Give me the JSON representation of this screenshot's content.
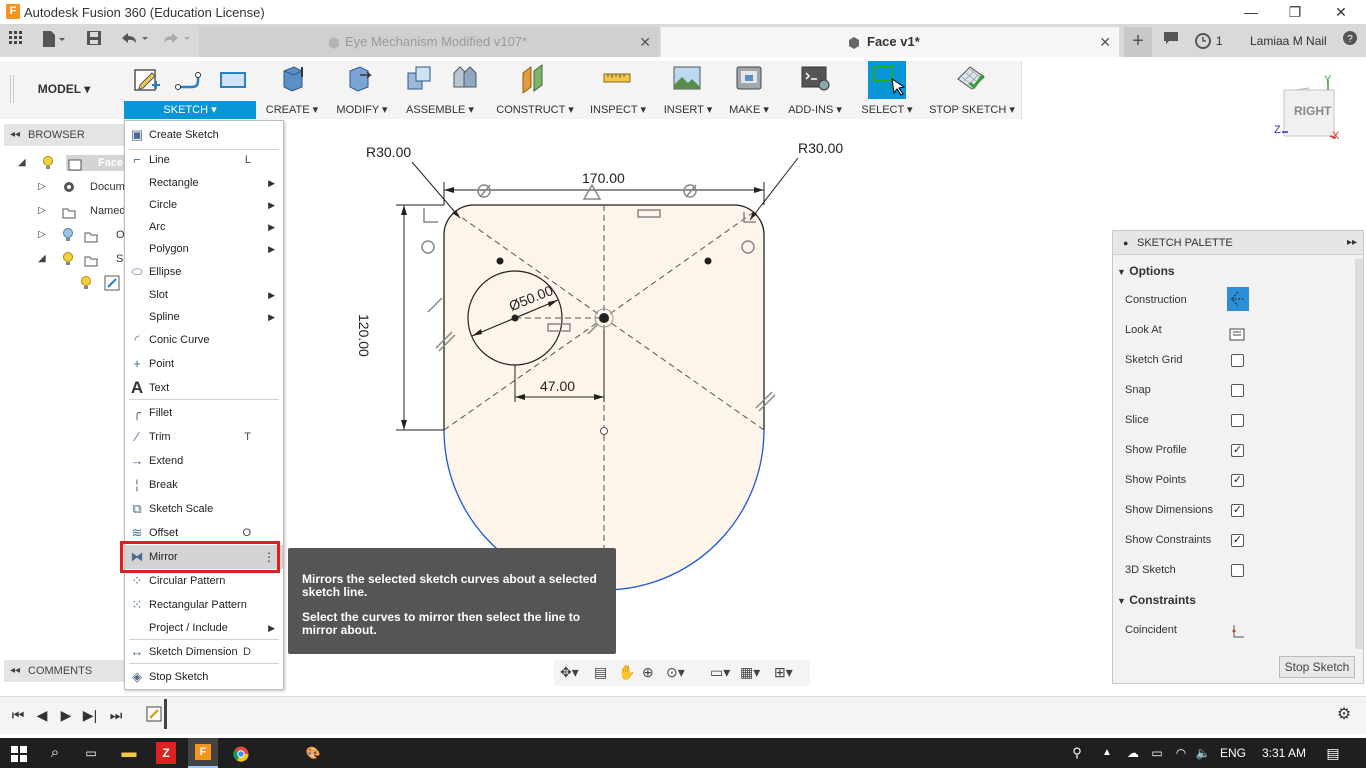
{
  "window": {
    "title": "Autodesk Fusion 360 (Education License)",
    "app_icon_letter": "F",
    "minimize": "—",
    "restore": "❐",
    "close": "✕"
  },
  "tabs": {
    "inactive": {
      "label": "Eye Mechanism Modified v107*",
      "close": "✕"
    },
    "active": {
      "label": "Face v1*",
      "close": "✕"
    },
    "new_tab": "+",
    "job_count": "1",
    "user": "Lamiaa M Nail"
  },
  "toolbar": {
    "workspace": "MODEL ▾",
    "groups": [
      {
        "label": "SKETCH ▾"
      },
      {
        "label": "CREATE ▾"
      },
      {
        "label": "MODIFY ▾"
      },
      {
        "label": "ASSEMBLE ▾"
      },
      {
        "label": "CONSTRUCT ▾"
      },
      {
        "label": "INSPECT ▾"
      },
      {
        "label": "INSERT ▾"
      },
      {
        "label": "MAKE ▾"
      },
      {
        "label": "ADD-INS ▾"
      },
      {
        "label": "SELECT ▾"
      },
      {
        "label": "STOP SKETCH ▾"
      }
    ]
  },
  "browser": {
    "header": "BROWSER",
    "items": [
      {
        "label": "Face"
      },
      {
        "label": "Docum"
      },
      {
        "label": "Named"
      },
      {
        "label": "O"
      },
      {
        "label": "S"
      }
    ]
  },
  "comments": {
    "header": "COMMENTS"
  },
  "sketch_menu": {
    "items": [
      {
        "label": "Create Sketch",
        "shortcut": ""
      },
      {
        "label": "Line",
        "shortcut": "L"
      },
      {
        "label": "Rectangle",
        "shortcut": ""
      },
      {
        "label": "Circle",
        "shortcut": ""
      },
      {
        "label": "Arc",
        "shortcut": ""
      },
      {
        "label": "Polygon",
        "shortcut": ""
      },
      {
        "label": "Ellipse",
        "shortcut": ""
      },
      {
        "label": "Slot",
        "shortcut": ""
      },
      {
        "label": "Spline",
        "shortcut": ""
      },
      {
        "label": "Conic Curve",
        "shortcut": ""
      },
      {
        "label": "Point",
        "shortcut": ""
      },
      {
        "label": "Text",
        "shortcut": ""
      },
      {
        "label": "Fillet",
        "shortcut": ""
      },
      {
        "label": "Trim",
        "shortcut": "T"
      },
      {
        "label": "Extend",
        "shortcut": ""
      },
      {
        "label": "Break",
        "shortcut": ""
      },
      {
        "label": "Sketch Scale",
        "shortcut": ""
      },
      {
        "label": "Offset",
        "shortcut": "O"
      },
      {
        "label": "Mirror",
        "shortcut": ""
      },
      {
        "label": "Circular Pattern",
        "shortcut": ""
      },
      {
        "label": "Rectangular Pattern",
        "shortcut": ""
      },
      {
        "label": "Project / Include",
        "shortcut": ""
      },
      {
        "label": "Sketch Dimension",
        "shortcut": "D"
      },
      {
        "label": "Stop Sketch",
        "shortcut": ""
      }
    ]
  },
  "tooltip": {
    "line1": "Mirrors the selected sketch curves about a selected sketch line.",
    "line2": "Select the curves to mirror then select the line to mirror about."
  },
  "canvas": {
    "dim_r_left": "R30.00",
    "dim_r_right": "R30.00",
    "dim_width": "170.00",
    "dim_height": "120.00",
    "dim_diameter": "Ø50.00",
    "dim_offset": "47.00"
  },
  "viewcube": {
    "face": "RIGHT",
    "axis_y": "Y",
    "axis_z": "Z",
    "axis_x": "X"
  },
  "palette": {
    "title": "SKETCH PALETTE",
    "options_header": "Options",
    "rows": [
      {
        "label": "Construction",
        "checked": ""
      },
      {
        "label": "Look At",
        "checked": ""
      },
      {
        "label": "Sketch Grid",
        "checked": ""
      },
      {
        "label": "Snap",
        "checked": ""
      },
      {
        "label": "Slice",
        "checked": ""
      },
      {
        "label": "Show Profile",
        "checked": "✓"
      },
      {
        "label": "Show Points",
        "checked": "✓"
      },
      {
        "label": "Show Dimensions",
        "checked": "✓"
      },
      {
        "label": "Show Constraints",
        "checked": "✓"
      },
      {
        "label": "3D Sketch",
        "checked": ""
      }
    ],
    "constraints_header": "Constraints",
    "constraint_item": "Coincident",
    "stop_button": "Stop Sketch"
  },
  "taskbar": {
    "language": "ENG",
    "time": "3:31 AM"
  },
  "colors": {
    "accent": "#0696d7",
    "highlight_box": "#e02020",
    "profile_fill": "#fdf4ea",
    "tooltip_bg": "#555555"
  }
}
